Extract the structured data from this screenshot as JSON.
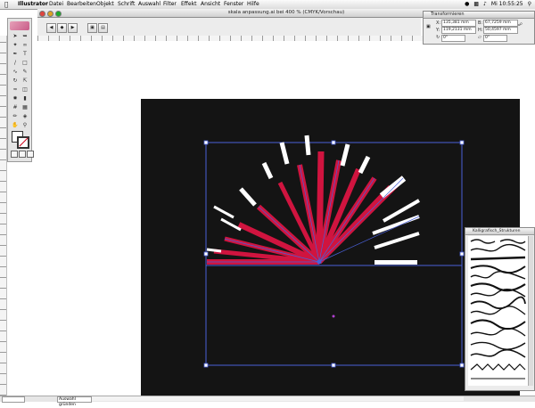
{
  "menubar": {
    "apple": "",
    "app_name": "Illustrator",
    "items": [
      "Datei",
      "Bearbeiten",
      "Objekt",
      "Schrift",
      "Auswahl",
      "Filter",
      "Effekt",
      "Ansicht",
      "Fenster",
      "Hilfe"
    ],
    "clock": "Mi 10:55:25"
  },
  "document": {
    "title": "skala anpassung.ai bei 400 % (CMYK/Vorschau)"
  },
  "transform_palette": {
    "title": "Transformieren",
    "x_value": "135,381 mm",
    "y_value": "119,2131 mm",
    "w_value": "67,7259 mm",
    "h_value": "50,4597 mm",
    "x_label": "X:",
    "y_label": "Y:",
    "w_label": "B:",
    "h_label": "H:",
    "angle_value": "0°",
    "shear_value": "0°"
  },
  "brushes_palette": {
    "title": "Kalligrafisch_Strukturen"
  },
  "statusbar": {
    "status_label": "Auswahl gründen"
  },
  "colors": {
    "accent_red": "#d0143f",
    "selection_blue": "#4a60d8",
    "artboard": "#141414",
    "white_stroke": "#ffffff"
  }
}
